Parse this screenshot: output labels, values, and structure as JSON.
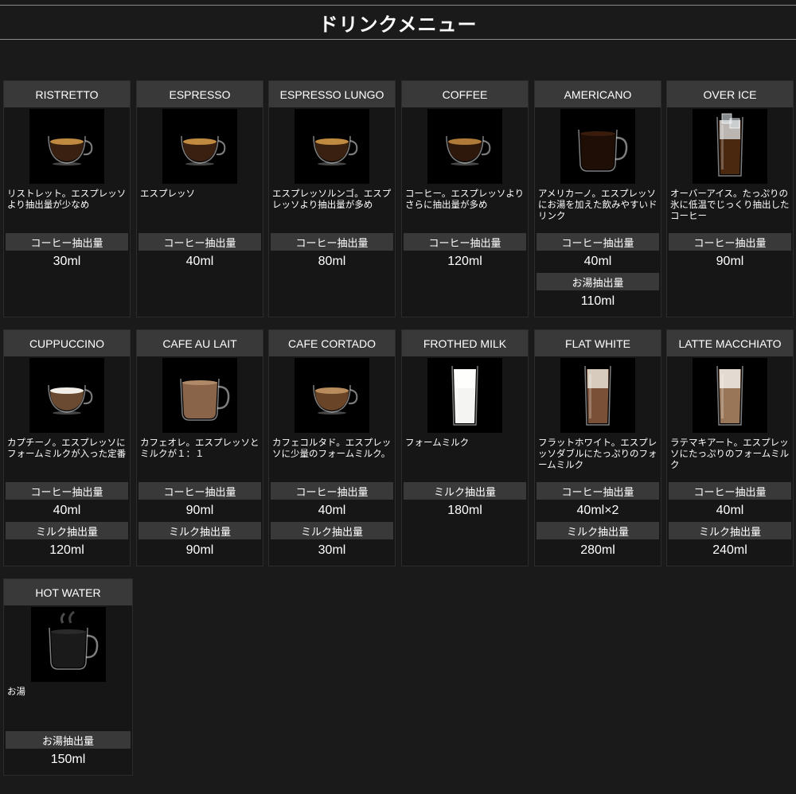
{
  "page": {
    "title": "ドリンクメニュー"
  },
  "drinks": [
    {
      "name": "RISTRETTO",
      "desc": "リストレット。エスプレッソより抽出量が少なめ",
      "icon": "ristretto-cup-icon",
      "fill": "#3a2010",
      "crema": "#c08a40",
      "specs": [
        {
          "label": "コーヒー抽出量",
          "value": "30ml"
        }
      ]
    },
    {
      "name": "ESPRESSO",
      "desc": "エスプレッソ",
      "icon": "espresso-cup-icon",
      "fill": "#3a2010",
      "crema": "#c08a40",
      "specs": [
        {
          "label": "コーヒー抽出量",
          "value": "40ml"
        }
      ]
    },
    {
      "name": "ESPRESSO LUNGO",
      "desc": "エスプレッソルンゴ。エスプレッソより抽出量が多め",
      "icon": "lungo-cup-icon",
      "fill": "#3a2010",
      "crema": "#c08a40",
      "specs": [
        {
          "label": "コーヒー抽出量",
          "value": "80ml"
        }
      ]
    },
    {
      "name": "COFFEE",
      "desc": "コーヒー。エスプレッソよりさらに抽出量が多め",
      "icon": "coffee-cup-icon",
      "fill": "#2e180c",
      "crema": "#b07a38",
      "specs": [
        {
          "label": "コーヒー抽出量",
          "value": "120ml"
        }
      ]
    },
    {
      "name": "AMERICANO",
      "desc": "アメリカーノ。エスプレッソにお湯を加えた飲みやすいドリンク",
      "icon": "americano-mug-icon",
      "fill": "#1e0e06",
      "crema": "#3a1c0c",
      "specs": [
        {
          "label": "コーヒー抽出量",
          "value": "40ml"
        },
        {
          "label": "お湯抽出量",
          "value": "110ml"
        }
      ]
    },
    {
      "name": "OVER ICE",
      "desc": "オーバーアイス。たっぷりの氷に低温でじっくり抽出したコーヒー",
      "icon": "iced-coffee-glass-icon",
      "fill": "#4a2810",
      "crema": "#cfcfcf",
      "specs": [
        {
          "label": "コーヒー抽出量",
          "value": "90ml"
        }
      ]
    },
    {
      "name": "CUPPUCCINO",
      "desc": "カプチーノ。エスプレッソにフォームミルクが入った定番",
      "icon": "cappuccino-cup-icon",
      "fill": "#6a4a30",
      "crema": "#f2ede6",
      "specs": [
        {
          "label": "コーヒー抽出量",
          "value": "40ml"
        },
        {
          "label": "ミルク抽出量",
          "value": "120ml"
        }
      ]
    },
    {
      "name": "CAFE AU LAIT",
      "desc": "カフェオレ。エスプレッソとミルクが１：１",
      "icon": "cafe-au-lait-mug-icon",
      "fill": "#8a6448",
      "crema": "#b08a68",
      "specs": [
        {
          "label": "コーヒー抽出量",
          "value": "90ml"
        },
        {
          "label": "ミルク抽出量",
          "value": "90ml"
        }
      ]
    },
    {
      "name": "CAFE CORTADO",
      "desc": "カフェコルタド。エスプレッソに少量のフォームミルク。",
      "icon": "cortado-cup-icon",
      "fill": "#6a4426",
      "crema": "#b88c5c",
      "specs": [
        {
          "label": "コーヒー抽出量",
          "value": "40ml"
        },
        {
          "label": "ミルク抽出量",
          "value": "30ml"
        }
      ]
    },
    {
      "name": "FROTHED MILK",
      "desc": "フォームミルク",
      "icon": "frothed-milk-glass-icon",
      "fill": "#f4f4f2",
      "crema": "#ffffff",
      "specs": [
        {
          "label": "ミルク抽出量",
          "value": "180ml"
        }
      ]
    },
    {
      "name": "FLAT WHITE",
      "desc": "フラットホワイト。エスプレッソダブルにたっぷりのフォームミルク",
      "icon": "flat-white-glass-icon",
      "fill": "#7a5036",
      "crema": "#e8e0d6",
      "specs": [
        {
          "label": "コーヒー抽出量",
          "value": "40ml×2"
        },
        {
          "label": "ミルク抽出量",
          "value": "280ml"
        }
      ]
    },
    {
      "name": "LATTE MACCHIATO",
      "desc": "ラテマキアート。エスプレッソにたっぷりのフォームミルク",
      "icon": "latte-macchiato-glass-icon",
      "fill": "#9a7658",
      "crema": "#f0ece6",
      "specs": [
        {
          "label": "コーヒー抽出量",
          "value": "40ml"
        },
        {
          "label": "ミルク抽出量",
          "value": "240ml"
        }
      ]
    },
    {
      "name": "HOT WATER",
      "desc": "お湯",
      "icon": "hot-water-mug-icon",
      "fill": "#1a1a1a",
      "crema": "#2a2a2a",
      "specs": [
        {
          "label": "お湯抽出量",
          "value": "150ml"
        }
      ]
    }
  ]
}
